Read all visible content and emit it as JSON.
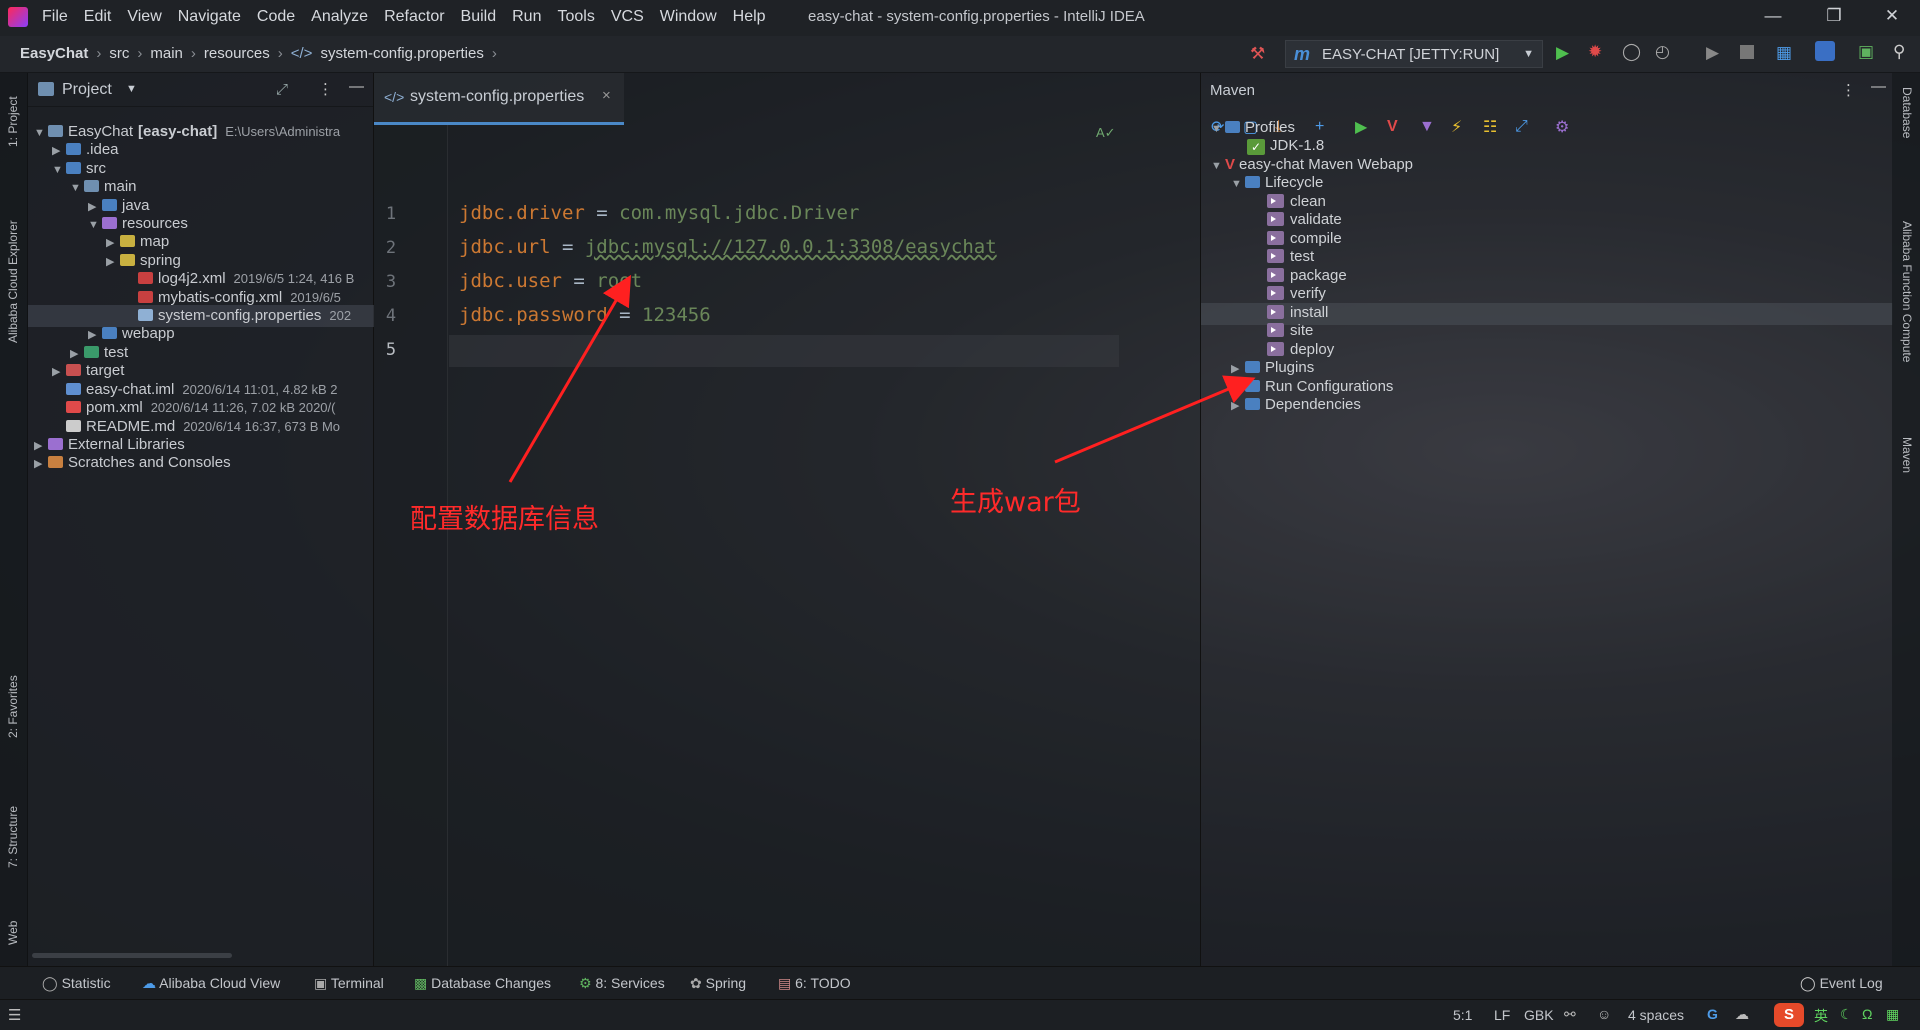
{
  "menu": [
    "File",
    "Edit",
    "View",
    "Navigate",
    "Code",
    "Analyze",
    "Refactor",
    "Build",
    "Run",
    "Tools",
    "VCS",
    "Window",
    "Help"
  ],
  "window_title": "easy-chat - system-config.properties - IntelliJ IDEA",
  "breadcrumb": [
    "EasyChat",
    "src",
    "main",
    "resources",
    "system-config.properties"
  ],
  "run_config": "EASY-CHAT [JETTY:RUN]",
  "left_tools": [
    "1: Project",
    "Alibaba Cloud Explorer",
    "2: Favorites",
    "7: Structure",
    "Web"
  ],
  "right_tools": [
    "Database",
    "Alibaba Function Compute",
    "Maven"
  ],
  "project": {
    "header": "Project",
    "items": [
      {
        "label": "EasyChat",
        "bold": "[easy-chat]",
        "meta": "E:\\Users\\Administra"
      },
      {
        "label": ".idea",
        "meta": ""
      },
      {
        "label": "src",
        "meta": ""
      },
      {
        "label": "main",
        "meta": ""
      },
      {
        "label": "java",
        "meta": ""
      },
      {
        "label": "resources",
        "meta": ""
      },
      {
        "label": "map",
        "meta": ""
      },
      {
        "label": "spring",
        "meta": ""
      },
      {
        "label": "log4j2.xml",
        "meta": "2019/6/5 1:24, 416 B"
      },
      {
        "label": "mybatis-config.xml",
        "meta": "2019/6/5"
      },
      {
        "label": "system-config.properties",
        "meta": "202"
      },
      {
        "label": "webapp",
        "meta": ""
      },
      {
        "label": "test",
        "meta": ""
      },
      {
        "label": "target",
        "meta": ""
      },
      {
        "label": "easy-chat.iml",
        "meta": "2020/6/14 11:01, 4.82 kB 2"
      },
      {
        "label": "pom.xml",
        "meta": "2020/6/14 11:26, 7.02 kB 2020/("
      },
      {
        "label": "README.md",
        "meta": "2020/6/14 16:37, 673 B Mo"
      },
      {
        "label": "External Libraries",
        "meta": ""
      },
      {
        "label": "Scratches and Consoles",
        "meta": ""
      }
    ]
  },
  "editor": {
    "tab": "system-config.properties",
    "line_numbers": [
      "1",
      "2",
      "3",
      "4",
      "5"
    ],
    "lines": [
      {
        "key": "jdbc.driver",
        "eq": " = ",
        "val": "com.mysql.jdbc.Driver"
      },
      {
        "key": "jdbc.url",
        "eq": " = ",
        "val": "jdbc:mysql://127.0.0.1:3308/easychat"
      },
      {
        "key": "jdbc.user",
        "eq": " = ",
        "val": "root"
      },
      {
        "key": "jdbc.password",
        "eq": " = ",
        "val": "123456"
      }
    ]
  },
  "maven": {
    "title": "Maven",
    "profiles": "Profiles",
    "jdk": "JDK-1.8",
    "project": "easy-chat Maven Webapp",
    "lifecycle": "Lifecycle",
    "goals": [
      "clean",
      "validate",
      "compile",
      "test",
      "package",
      "verify",
      "install",
      "site",
      "deploy"
    ],
    "plugins": "Plugins",
    "run_configs": "Run Configurations",
    "dependencies": "Dependencies"
  },
  "annotations": {
    "left": "配置数据库信息",
    "right": "生成war包"
  },
  "bottom_tools": [
    "Statistic",
    "Alibaba Cloud View",
    "Terminal",
    "Database Changes",
    "8: Services",
    "Spring",
    "6: TODO"
  ],
  "event_log": "Event Log",
  "status": {
    "position": "5:1",
    "line_sep": "LF",
    "encoding": "GBK",
    "indent": "4 spaces",
    "ime": "英"
  }
}
